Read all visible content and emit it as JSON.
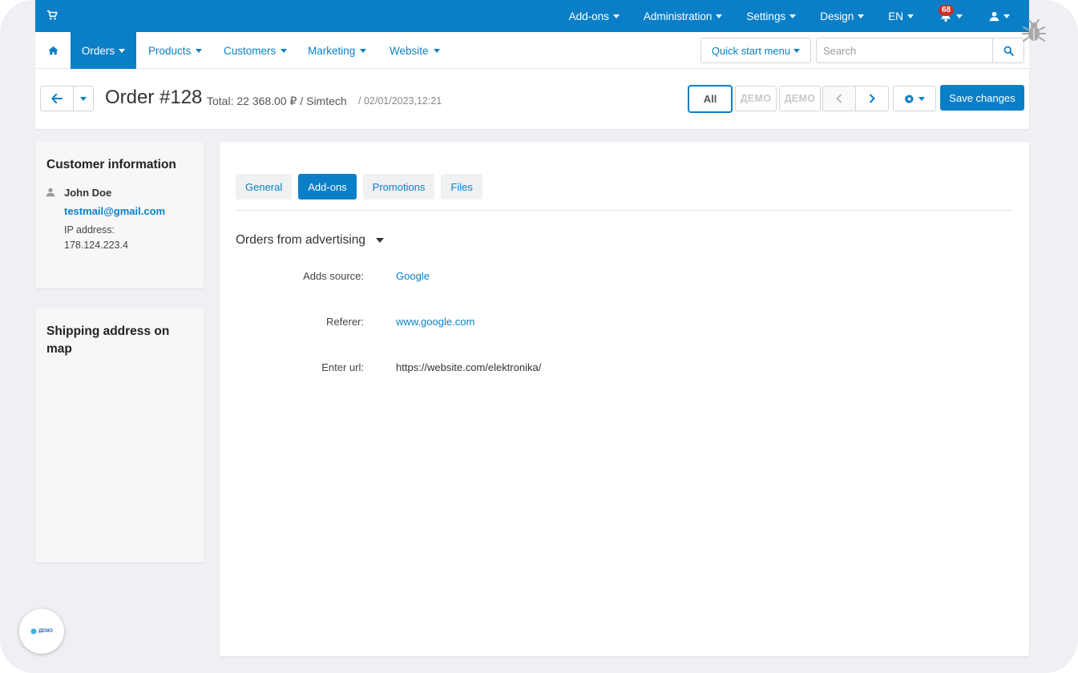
{
  "topbar": {
    "menu": [
      "Add-ons",
      "Administration",
      "Settings",
      "Design",
      "EN"
    ],
    "notifications_count": "68"
  },
  "nav": {
    "orders": "Orders",
    "products": "Products",
    "customers": "Customers",
    "marketing": "Marketing",
    "website": "Website",
    "quick_start": "Quick start menu",
    "search_placeholder": "Search"
  },
  "header": {
    "title": "Order #128",
    "meta": "Total: 22 368.00 ₽ / Simtech",
    "date": "/ 02/01/2023,12:21",
    "all_label": "All",
    "demo_label_1": "ДЕМО",
    "demo_label_2": "ДЕМО",
    "save_label": "Save changes"
  },
  "customer": {
    "heading": "Customer information",
    "name": "John Doe",
    "email": "testmail@gmail.com",
    "ip_label": "IP address:",
    "ip_value": "178.124.223.4"
  },
  "shipping": {
    "heading": "Shipping address on map"
  },
  "tabs": [
    "General",
    "Add-ons",
    "Promotions",
    "Files"
  ],
  "active_tab": "Add-ons",
  "section": {
    "title": "Orders from advertising",
    "fields": [
      {
        "label": "Adds source:",
        "value": "Google"
      },
      {
        "label": "Referer:",
        "value": "www.google.com"
      },
      {
        "label": "Enter url:",
        "value": "https://website.com/elektronika/"
      }
    ]
  },
  "colors": {
    "accent": "#0a7fc7",
    "badge": "#c9302c"
  },
  "demo_badge": "ДЕМО"
}
